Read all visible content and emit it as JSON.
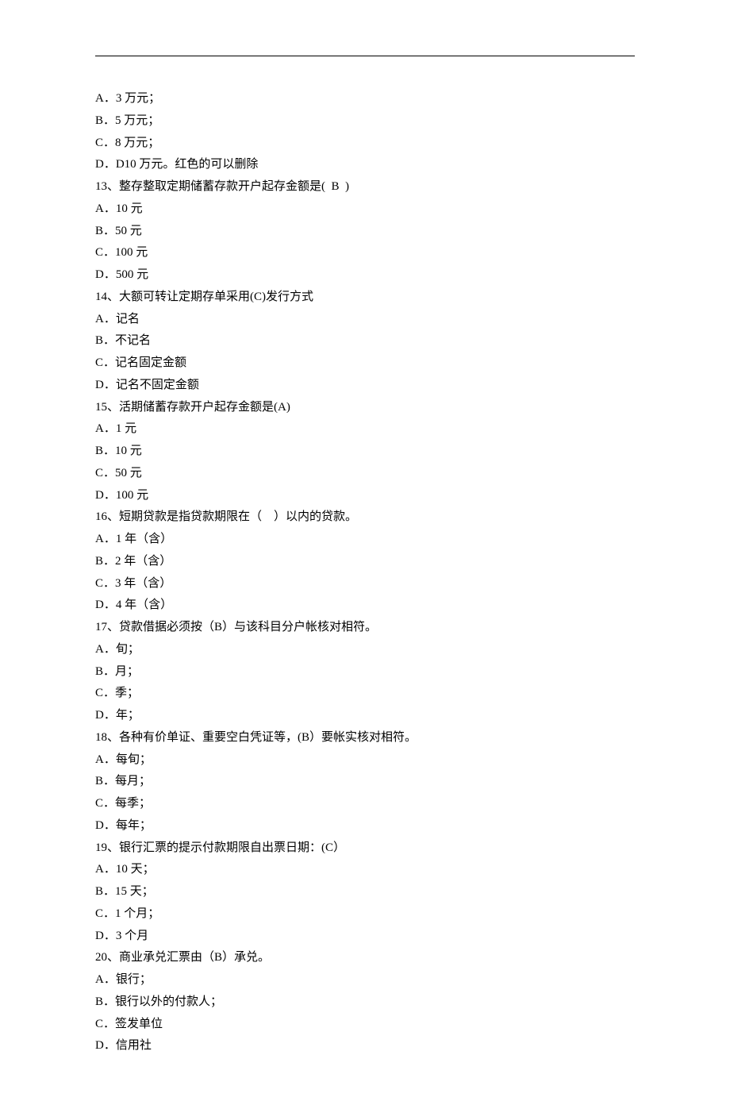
{
  "lines": [
    "A．3 万元；",
    "B．5 万元；",
    "C．8 万元；",
    "D．D10 万元。红色的可以删除",
    "13、整存整取定期储蓄存款开户起存金额是(  B  )",
    "A．10 元",
    "B．50 元",
    "C．100 元",
    "D．500 元",
    "14、大额可转让定期存单采用(C)发行方式",
    "A．记名",
    "B．不记名",
    "C．记名固定金额",
    "D．记名不固定金额",
    "15、活期储蓄存款开户起存金额是(A)",
    "A．1 元",
    "B．10 元",
    "C．50 元",
    "D．100 元",
    "16、短期贷款是指贷款期限在（    ）以内的贷款。",
    "A．1 年（含）",
    "B．2 年（含）",
    "C．3 年（含）",
    "D．4 年（含）",
    "17、贷款借据必须按（B）与该科目分户帐核对相符。",
    "A．旬；",
    "B．月；",
    "C．季；",
    "D．年；",
    "18、各种有价单证、重要空白凭证等，(B）要帐实核对相符。",
    "A．每旬；",
    "B．每月；",
    "C．每季；",
    "D．每年；",
    "19、银行汇票的提示付款期限自出票日期：(C）",
    "A．10 天；",
    "B．15 天；",
    "C．1 个月；",
    "D．3 个月",
    "20、商业承兑汇票由（B）承兑。",
    "A．银行；",
    "B．银行以外的付款人；",
    "C．签发单位",
    "D．信用社"
  ]
}
